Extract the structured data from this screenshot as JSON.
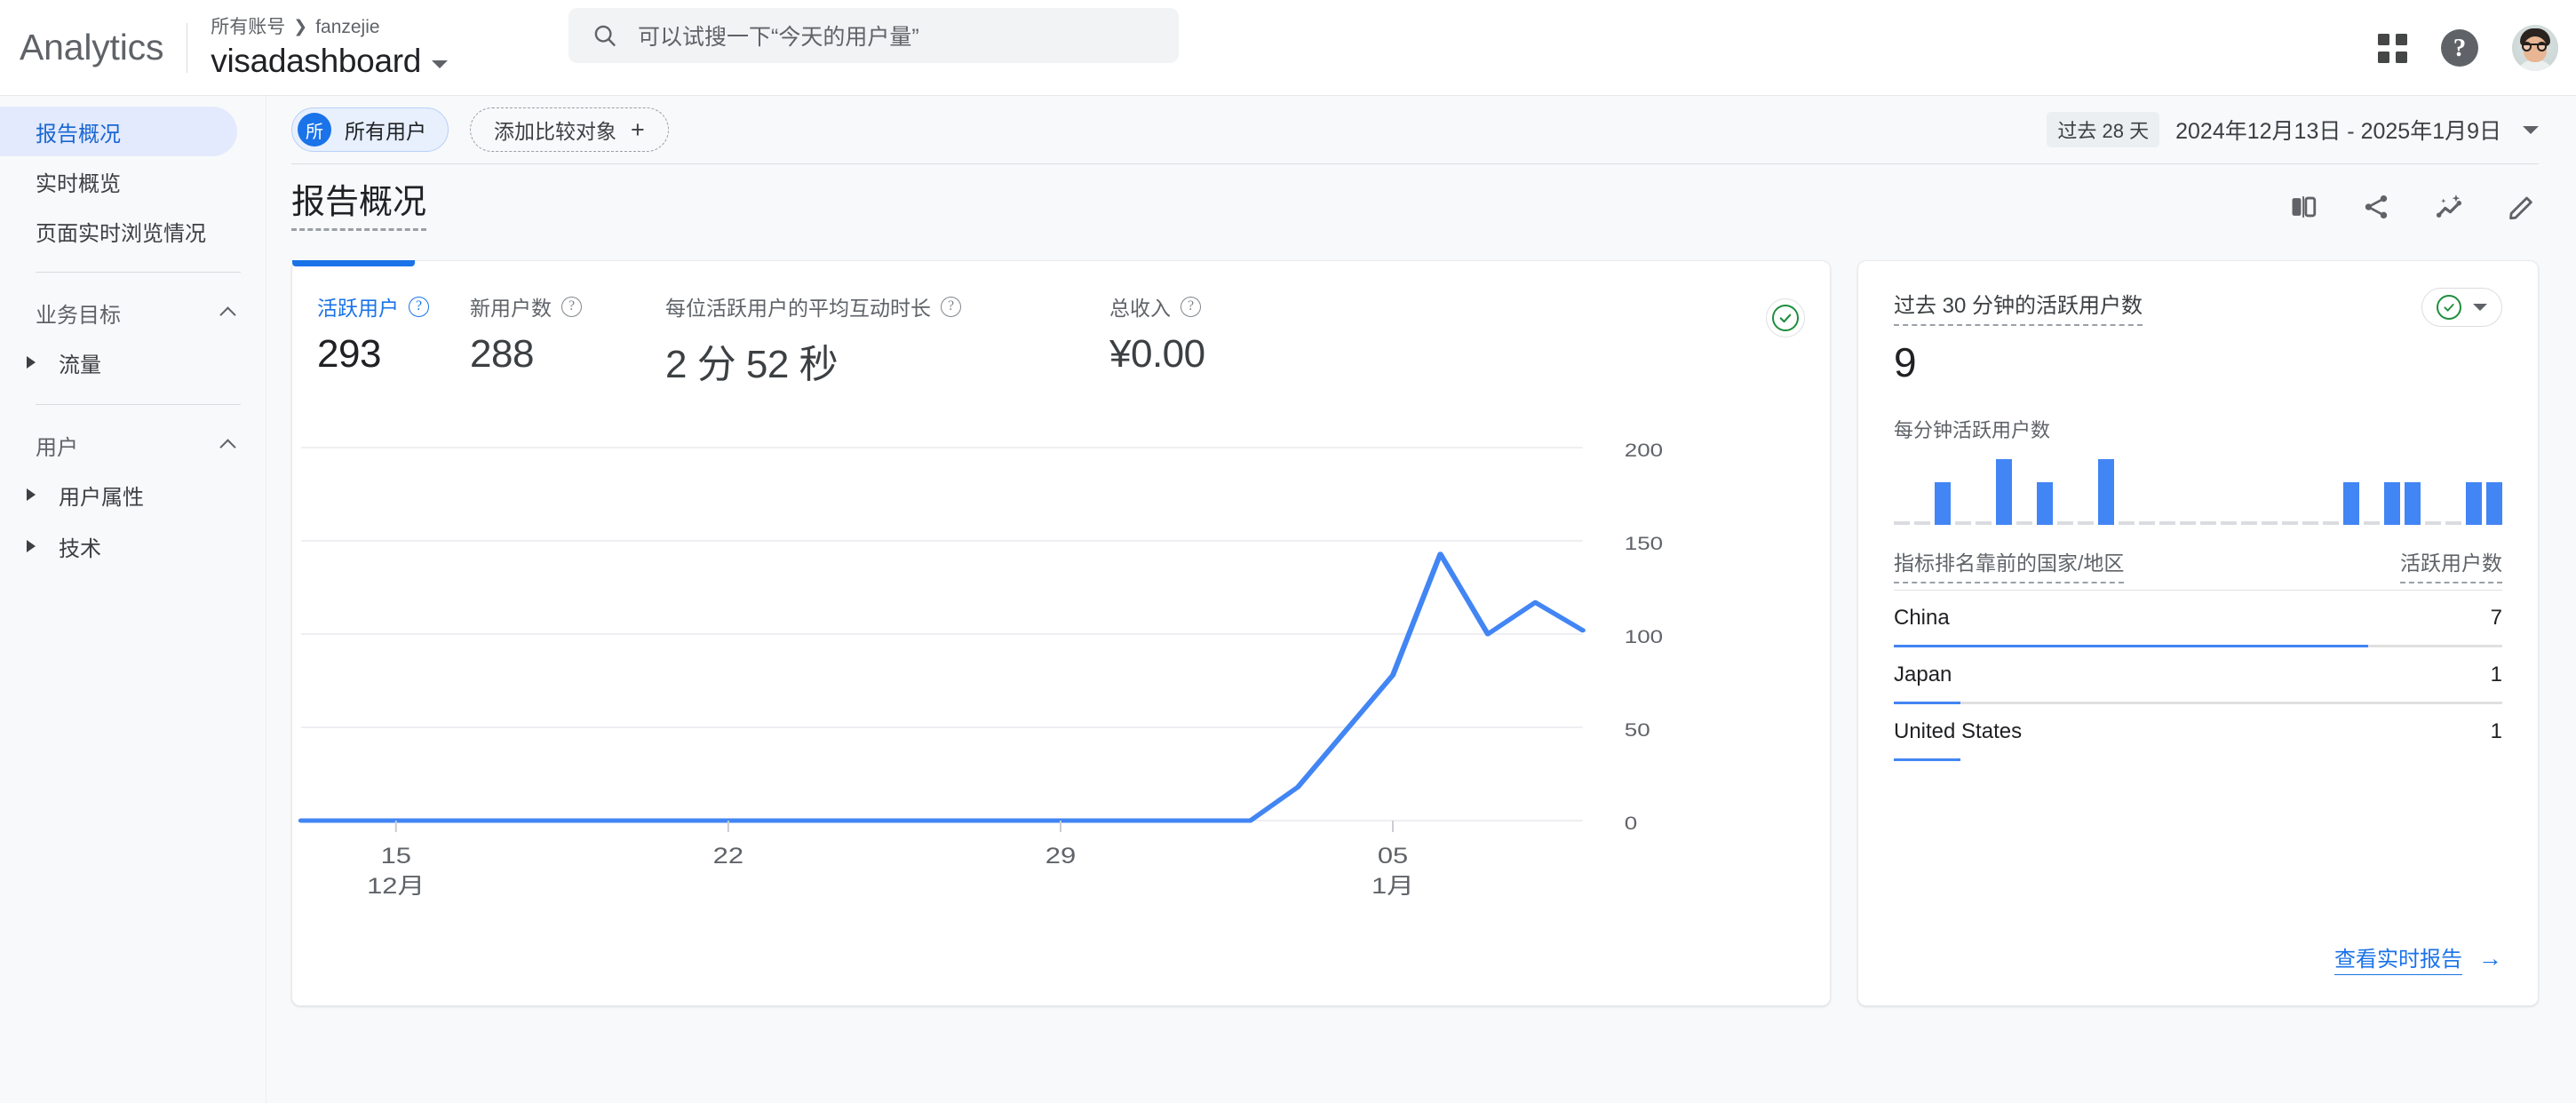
{
  "header": {
    "brand": "Analytics",
    "breadcrumb_account": "所有账号",
    "breadcrumb_sep": "❯",
    "breadcrumb_property": "fanzejie",
    "property_name": "visadashboard",
    "search_placeholder": "可以试搜一下“今天的用户量”",
    "apps_icon": "apps-grid-icon",
    "help_icon": "help-icon",
    "avatar_icon": "user-avatar"
  },
  "sidebar": {
    "items": [
      {
        "label": "报告概况",
        "active": true
      },
      {
        "label": "实时概览",
        "active": false
      },
      {
        "label": "页面实时浏览情况",
        "active": false
      }
    ],
    "groups": [
      {
        "label": "业务目标",
        "expanded": true,
        "children": [
          {
            "label": "流量"
          }
        ]
      },
      {
        "label": "用户",
        "expanded": true,
        "children": [
          {
            "label": "用户属性"
          },
          {
            "label": "技术"
          }
        ]
      }
    ]
  },
  "controls": {
    "segment_badge": "所",
    "segment_label": "所有用户",
    "add_comparison_label": "添加比较对象",
    "add_comparison_icon": "plus-icon",
    "date_pill": "过去 28 天",
    "date_range": "2024年12月13日 - 2025年1月9日",
    "date_caret_icon": "chevron-down-icon"
  },
  "page": {
    "title": "报告概况",
    "tools": [
      {
        "name": "compare-split-icon"
      },
      {
        "name": "share-icon"
      },
      {
        "name": "insights-sparkle-icon"
      },
      {
        "name": "edit-pencil-icon"
      }
    ]
  },
  "metrics": [
    {
      "label": "活跃用户",
      "value": "293",
      "active": true
    },
    {
      "label": "新用户数",
      "value": "288",
      "active": false
    },
    {
      "label": "每位活跃用户的平均互动时长",
      "value": "2 分 52 秒",
      "active": false
    },
    {
      "label": "总收入",
      "value": "¥0.00",
      "active": false
    }
  ],
  "data_status_icon": "check-circle-green-icon",
  "realtime": {
    "title": "过去 30 分钟的活跃用户数",
    "value": "9",
    "status_icon": "check-circle-green-icon",
    "status_caret_icon": "chevron-down-icon",
    "per_minute_label": "每分钟活跃用户数",
    "table_header_dimension": "指标排名靠前的国家/地区",
    "table_header_metric": "活跃用户数",
    "rows": [
      {
        "country": "China",
        "users": "7",
        "pct": 78
      },
      {
        "country": "Japan",
        "users": "1",
        "pct": 11
      },
      {
        "country": "United States",
        "users": "1",
        "pct": 11
      }
    ],
    "link_label": "查看实时报告",
    "link_icon": "arrow-right-icon"
  },
  "colors": {
    "accent_blue": "#1a73e8",
    "line_blue": "#4285f4",
    "ok_green": "#1e8e3e",
    "bg_gray": "#f8f9fa",
    "text_primary": "#202124",
    "text_secondary": "#5f6368"
  },
  "chart_data": {
    "type": "line",
    "title": "活跃用户",
    "xlabel": "",
    "ylabel": "",
    "ylim": [
      0,
      200
    ],
    "yticks": [
      0,
      50,
      100,
      150,
      200
    ],
    "grid": true,
    "legend": false,
    "x_tick_labels": [
      {
        "pos": 2,
        "line1": "15",
        "line2": "12月"
      },
      {
        "pos": 9,
        "line1": "22",
        "line2": ""
      },
      {
        "pos": 16,
        "line1": "29",
        "line2": ""
      },
      {
        "pos": 23,
        "line1": "05",
        "line2": "1月"
      }
    ],
    "x": [
      "12-13",
      "12-14",
      "12-15",
      "12-16",
      "12-17",
      "12-18",
      "12-19",
      "12-20",
      "12-21",
      "12-22",
      "12-23",
      "12-24",
      "12-25",
      "12-26",
      "12-27",
      "12-28",
      "12-29",
      "12-30",
      "12-31",
      "01-01",
      "01-02",
      "01-03",
      "01-04",
      "01-05",
      "01-06",
      "01-07",
      "01-08",
      "01-09"
    ],
    "series": [
      {
        "name": "活跃用户",
        "color": "#4285f4",
        "values": [
          0,
          0,
          0,
          0,
          0,
          0,
          0,
          0,
          0,
          0,
          0,
          0,
          0,
          0,
          0,
          0,
          0,
          0,
          0,
          0,
          0,
          18,
          48,
          78,
          143,
          100,
          117,
          102
        ]
      }
    ]
  },
  "realtime_chart_data": {
    "type": "bar",
    "title": "每分钟活跃用户数",
    "categories": [
      "-30",
      "-29",
      "-28",
      "-27",
      "-26",
      "-25",
      "-24",
      "-23",
      "-22",
      "-21",
      "-20",
      "-19",
      "-18",
      "-17",
      "-16",
      "-15",
      "-14",
      "-13",
      "-12",
      "-11",
      "-10",
      "-9",
      "-8",
      "-7",
      "-6",
      "-5",
      "-4",
      "-3",
      "-2",
      "-1"
    ],
    "values": [
      0,
      0,
      1,
      0,
      0,
      2,
      0,
      1,
      0,
      0,
      2,
      0,
      0,
      0,
      0,
      0,
      0,
      0,
      0,
      0,
      0,
      0,
      1,
      0,
      1,
      1,
      0,
      0,
      1,
      1
    ],
    "ylim": [
      0,
      2
    ],
    "color": "#4285f4",
    "zero_color": "#dadce0"
  }
}
